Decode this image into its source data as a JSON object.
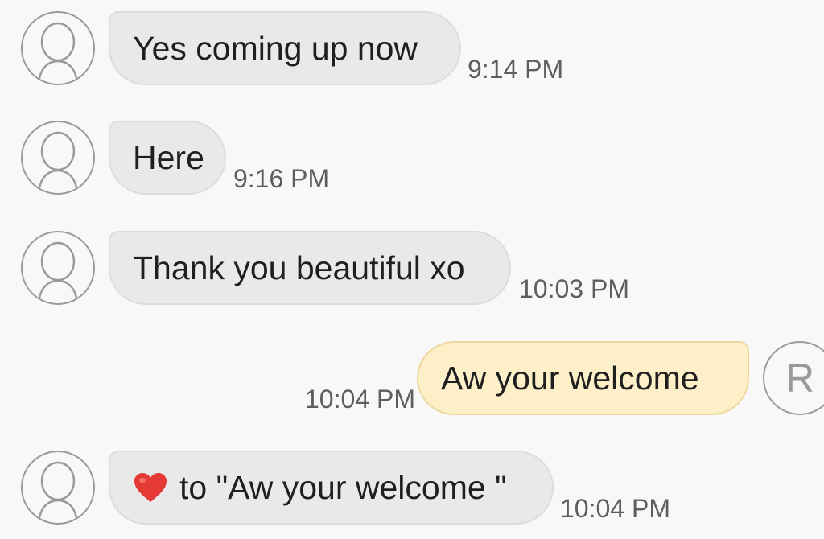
{
  "messages": [
    {
      "direction": "incoming",
      "text": "Yes coming up now",
      "time": "9:14 PM",
      "avatar_icon": "person-silhouette-icon"
    },
    {
      "direction": "incoming",
      "text": "Here",
      "time": "9:16 PM",
      "avatar_icon": "person-silhouette-icon"
    },
    {
      "direction": "incoming",
      "text": "Thank you beautiful xo",
      "time": "10:03 PM",
      "avatar_icon": "person-silhouette-icon"
    },
    {
      "direction": "outgoing",
      "text": "Aw your welcome",
      "time": "10:04 PM",
      "avatar_letter": "R"
    },
    {
      "direction": "incoming",
      "reaction_icon": "red-heart-icon",
      "text": "to \"Aw your welcome \"",
      "time": "10:04 PM",
      "avatar_icon": "person-silhouette-icon"
    }
  ],
  "colors": {
    "background": "#f8f8f8",
    "incoming_bubble": "#e9e9e9",
    "outgoing_bubble": "#fdf0c8",
    "timestamp": "#5e5e5e",
    "heart": "#e53935"
  }
}
